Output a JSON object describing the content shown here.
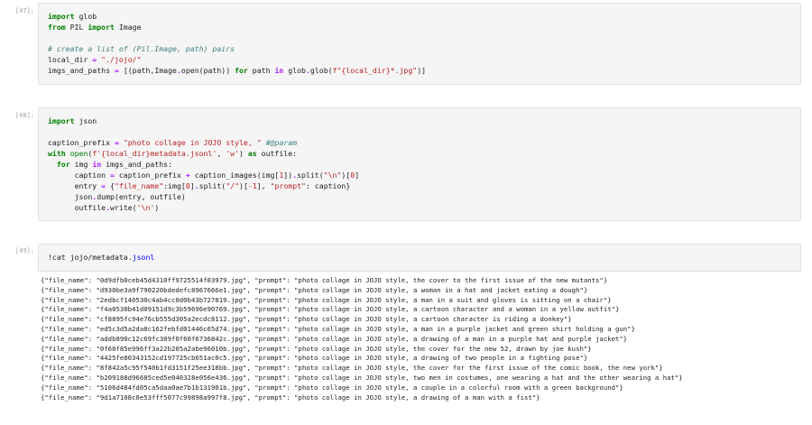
{
  "cells": [
    {
      "prompt": "[47]:",
      "lines": [
        [
          {
            "t": "import",
            "c": "kw"
          },
          {
            "t": " glob",
            "c": ""
          }
        ],
        [
          {
            "t": "from",
            "c": "kw"
          },
          {
            "t": " PIL ",
            "c": ""
          },
          {
            "t": "import",
            "c": "kw"
          },
          {
            "t": " Image",
            "c": ""
          }
        ],
        [
          {
            "t": "",
            "c": ""
          }
        ],
        [
          {
            "t": "# create a list of (Pil.Image, path) pairs",
            "c": "cm"
          }
        ],
        [
          {
            "t": "local_dir ",
            "c": ""
          },
          {
            "t": "=",
            "c": "op"
          },
          {
            "t": " ",
            "c": ""
          },
          {
            "t": "\"./jojo/\"",
            "c": "str"
          }
        ],
        [
          {
            "t": "imgs_and_paths ",
            "c": ""
          },
          {
            "t": "=",
            "c": "op"
          },
          {
            "t": " [(path,Image",
            "c": ""
          },
          {
            "t": ".",
            "c": "op"
          },
          {
            "t": "open(path)) ",
            "c": ""
          },
          {
            "t": "for",
            "c": "kw"
          },
          {
            "t": " path ",
            "c": ""
          },
          {
            "t": "in",
            "c": "op"
          },
          {
            "t": " glob",
            "c": ""
          },
          {
            "t": ".",
            "c": "op"
          },
          {
            "t": "glob(",
            "c": ""
          },
          {
            "t": "f\"{local_dir}*.jpg\"",
            "c": "str"
          },
          {
            "t": ")]",
            "c": ""
          }
        ]
      ]
    },
    {
      "prompt": "[48]:",
      "lines": [
        [
          {
            "t": "import",
            "c": "kw"
          },
          {
            "t": " json",
            "c": ""
          }
        ],
        [
          {
            "t": "",
            "c": ""
          }
        ],
        [
          {
            "t": "caption_prefix ",
            "c": ""
          },
          {
            "t": "=",
            "c": "op"
          },
          {
            "t": " ",
            "c": ""
          },
          {
            "t": "\"photo collage in JOJO style, \"",
            "c": "str"
          },
          {
            "t": " ",
            "c": ""
          },
          {
            "t": "#@param",
            "c": "cm"
          }
        ],
        [
          {
            "t": "with",
            "c": "kw"
          },
          {
            "t": " ",
            "c": ""
          },
          {
            "t": "open",
            "c": "bi"
          },
          {
            "t": "(",
            "c": ""
          },
          {
            "t": "f'{local_dir}metadata.jsonl'",
            "c": "str"
          },
          {
            "t": ", ",
            "c": ""
          },
          {
            "t": "'w'",
            "c": "str"
          },
          {
            "t": ") ",
            "c": ""
          },
          {
            "t": "as",
            "c": "kw"
          },
          {
            "t": " outfile:",
            "c": ""
          }
        ],
        [
          {
            "t": "  ",
            "c": ""
          },
          {
            "t": "for",
            "c": "kw"
          },
          {
            "t": " img ",
            "c": ""
          },
          {
            "t": "in",
            "c": "op"
          },
          {
            "t": " imgs_and_paths:",
            "c": ""
          }
        ],
        [
          {
            "t": "      caption ",
            "c": ""
          },
          {
            "t": "=",
            "c": "op"
          },
          {
            "t": " caption_prefix ",
            "c": ""
          },
          {
            "t": "+",
            "c": "op"
          },
          {
            "t": " caption_images(img[",
            "c": ""
          },
          {
            "t": "1",
            "c": "str"
          },
          {
            "t": "])",
            "c": ""
          },
          {
            "t": ".",
            "c": "op"
          },
          {
            "t": "split(",
            "c": ""
          },
          {
            "t": "\"\\n\"",
            "c": "str"
          },
          {
            "t": ")[",
            "c": ""
          },
          {
            "t": "0",
            "c": "str"
          },
          {
            "t": "]",
            "c": ""
          }
        ],
        [
          {
            "t": "      entry ",
            "c": ""
          },
          {
            "t": "=",
            "c": "op"
          },
          {
            "t": " {",
            "c": ""
          },
          {
            "t": "\"file_name\"",
            "c": "str"
          },
          {
            "t": ":img[",
            "c": ""
          },
          {
            "t": "0",
            "c": "str"
          },
          {
            "t": "]",
            "c": ""
          },
          {
            "t": ".",
            "c": "op"
          },
          {
            "t": "split(",
            "c": ""
          },
          {
            "t": "\"/\"",
            "c": "str"
          },
          {
            "t": ")[",
            "c": ""
          },
          {
            "t": "-1",
            "c": "str"
          },
          {
            "t": "], ",
            "c": ""
          },
          {
            "t": "\"prompt\"",
            "c": "str"
          },
          {
            "t": ": caption}",
            "c": ""
          }
        ],
        [
          {
            "t": "      json",
            "c": ""
          },
          {
            "t": ".",
            "c": "op"
          },
          {
            "t": "dump(entry, outfile)",
            "c": ""
          }
        ],
        [
          {
            "t": "      outfile",
            "c": ""
          },
          {
            "t": ".",
            "c": "op"
          },
          {
            "t": "write(",
            "c": ""
          },
          {
            "t": "'\\n'",
            "c": "str"
          },
          {
            "t": ")",
            "c": ""
          }
        ]
      ]
    },
    {
      "prompt": "[49]:",
      "lines": [
        [
          {
            "t": "!cat jojo/metadata.",
            "c": ""
          },
          {
            "t": "jsonl",
            "c": "fn"
          }
        ]
      ]
    }
  ],
  "output_lines": [
    "{\"file_name\": \"0d9dfb0ceb45d4310ff9725514f03979.jpg\", \"prompt\": \"photo collage in JOJO style, the cover to the first issue of the new mutants\"}",
    "{\"file_name\": \"d930be3a9f790220bdedefc8967666e1.jpg\", \"prompt\": \"photo collage in JOJO style, a woman in a hat and jacket eating a dough\"}",
    "{\"file_name\": \"2edbcf140530c4ab4cc0d0b43b727819.jpg\", \"prompt\": \"photo collage in JOJO style, a man in a suit and gloves is sitting on a chair\"}",
    "{\"file_name\": \"f4a0530b41d09151d9c3b59696e90769.jpg\", \"prompt\": \"photo collage in JOJO style, a cartoon character and a woman in a yellow outfit\"}",
    "{\"file_name\": \"cf8895fc94e76cb555d305a2ecdc8112.jpg\", \"prompt\": \"photo collage in JOJO style, a cartoon character is riding a donkey\"}",
    "{\"file_name\": \"ed5c3d5a2da8c162febfd01446c65d74.jpg\", \"prompt\": \"photo collage in JOJO style, a man in a purple jacket and green shirt holding a gun\"}",
    "{\"file_name\": \"addb890c12c69fc309f0f60f6736842c.jpg\", \"prompt\": \"photo collage in JOJO style, a drawing of a man in a purple hat and purple jacket\"}",
    "{\"file_name\": \"0f60f85e996ff3a22b205a2abe96010b.jpg\", \"prompt\": \"photo collage in JOJO style, the cover for the new 52, drawn by joe kush\"}",
    "{\"file_name\": \"4425fe80343152cd197725cb651ac0c5.jpg\", \"prompt\": \"photo collage in JOJO style, a drawing of two people in a fighting pose\"}",
    "{\"file_name\": \"8f842a5c95f540b1fd3151f25ee318bb.jpg\", \"prompt\": \"photo collage in JOJO style, the cover for the first issue of the comic book, the new york\"}",
    "{\"file_name\": \"b209188d96685ced5e040328e056e436.jpg\", \"prompt\": \"photo collage in JOJO style, two men in costumes, one wearing a hat and the other wearing a hat\"}",
    "{\"file_name\": \"5106d484fd05ca5daa0ae7b1b131901b.jpg\", \"prompt\": \"photo collage in JOJO style, a couple in a colorful room with a green background\"}",
    "{\"file_name\": \"9d1a7108c0e53fff5077c99898a997f8.jpg\", \"prompt\": \"photo collage in JOJO style, a drawing of a man with a fist\"}"
  ]
}
